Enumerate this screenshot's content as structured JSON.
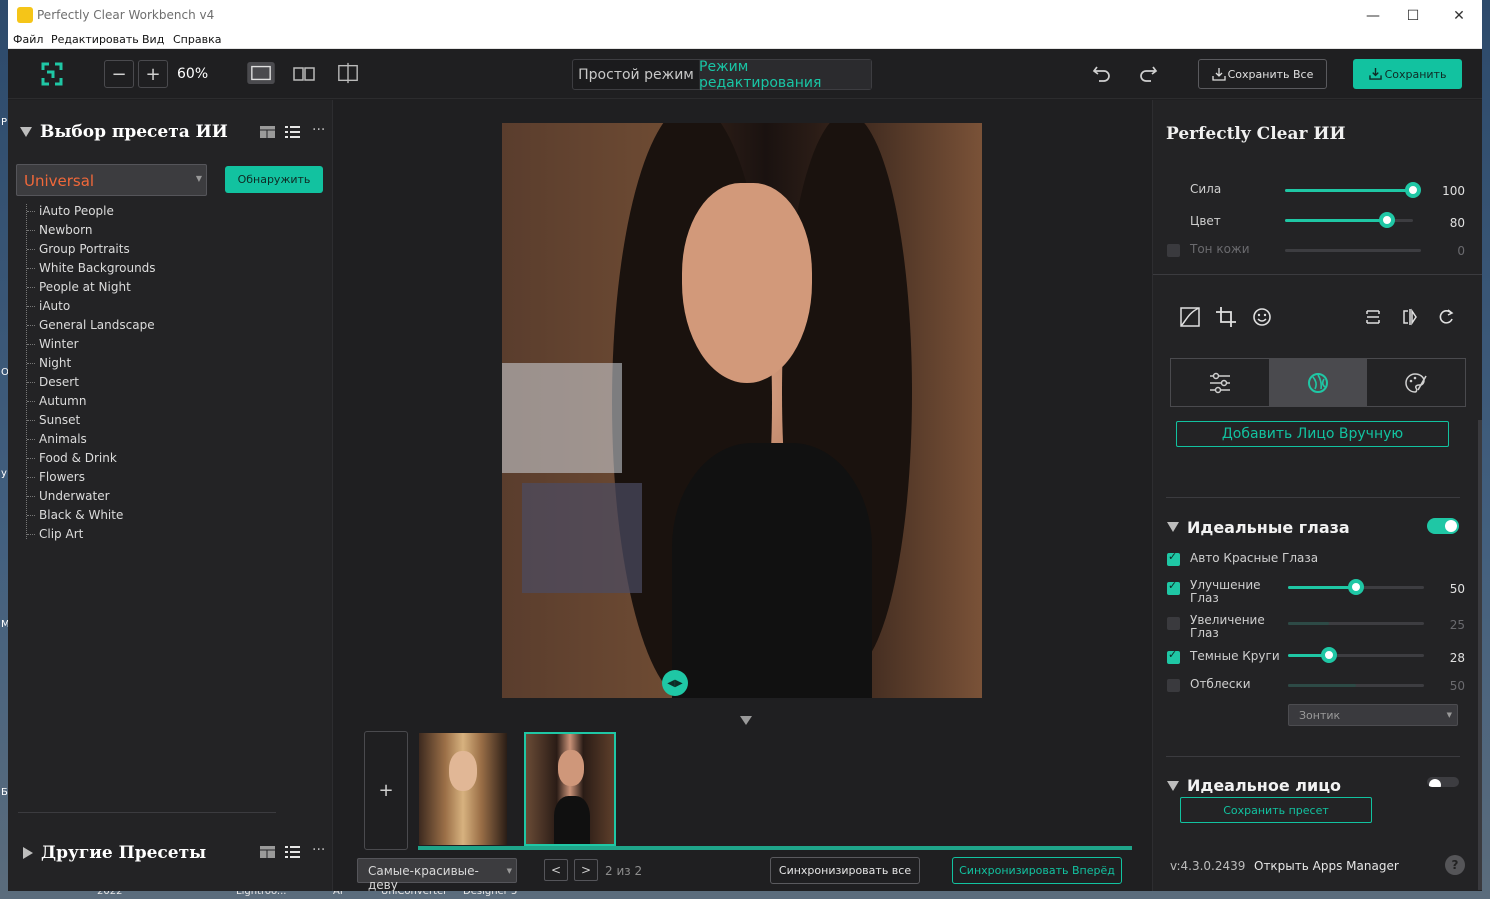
{
  "window": {
    "title": "Perfectly Clear Workbench v4",
    "controls": {
      "minimize": "—",
      "maximize": "☐",
      "close": "✕"
    }
  },
  "menu": [
    "Файл",
    "Редактировать",
    "Вид",
    "Справка"
  ],
  "toolbar": {
    "zoom_out": "−",
    "zoom_in": "+",
    "zoom": "60%",
    "mode_simple": "Простой режим",
    "mode_edit": "Режим редактирования",
    "save_all": "Сохранить Все",
    "save": "Сохранить"
  },
  "left_panel": {
    "title": "Выбор пресета ИИ",
    "preset_selected": "Universal",
    "detect_button": "Обнаружить",
    "presets": [
      "iAuto People",
      "Newborn",
      "Group Portraits",
      "White Backgrounds",
      "People at Night",
      "iAuto",
      "General Landscape",
      "Winter",
      "Night",
      "Desert",
      "Autumn",
      "Sunset",
      "Animals",
      "Food & Drink",
      "Flowers",
      "Underwater",
      "Black & White",
      "Clip Art"
    ],
    "other_title": "Другие Пресеты"
  },
  "center": {
    "add_label": "+",
    "sequence": "Самые-красивые-деву",
    "prev": "<",
    "next": ">",
    "page_info": "2 из 2",
    "sync_all": "Синхронизировать все",
    "sync_forward": "Синхронизировать Вперёд"
  },
  "right_panel": {
    "title": "Perfectly Clear ИИ",
    "sliders": [
      {
        "label": "Сила",
        "value": "100",
        "fraction": 1.0
      },
      {
        "label": "Цвет",
        "value": "80",
        "fraction": 0.8
      },
      {
        "label": "Тон кожи",
        "value": "0",
        "fraction": 0.0
      }
    ],
    "add_face": "Добавить Лицо Вручную",
    "eyes_section": "Идеальные глаза",
    "eyes_enabled": true,
    "eye_controls": [
      {
        "label": "Авто Красные Глаза",
        "checked": true
      },
      {
        "label": "Улучшение Глаз",
        "value": "50",
        "fraction": 0.5,
        "checked": true
      },
      {
        "label": "Увеличение Глаз",
        "value": "25",
        "fraction": 0.3,
        "checked": false
      },
      {
        "label": "Темные Круги",
        "value": "28",
        "fraction": 0.3,
        "checked": true
      },
      {
        "label": "Отблески",
        "value": "50",
        "fraction": 0.5,
        "checked": false
      }
    ],
    "umbrella": "Зонтик",
    "face_section": "Идеальное лицо",
    "face_enabled": false,
    "save_preset": "Сохранить пресет",
    "version": "v:4.3.0.2439",
    "apps_manager": "Открыть Apps Manager",
    "help": "?"
  },
  "taskbar": {
    "items": [
      "2022",
      "Lightroo...",
      "AI",
      "UniConverter",
      "Designer 5"
    ]
  },
  "desktop_left": [
    "P",
    "O",
    "y",
    "M",
    "Б"
  ],
  "colors": {
    "accent": "#12c2a0",
    "panel": "#232325",
    "window": "#1f1f21",
    "preset_orange": "#f0683a"
  }
}
